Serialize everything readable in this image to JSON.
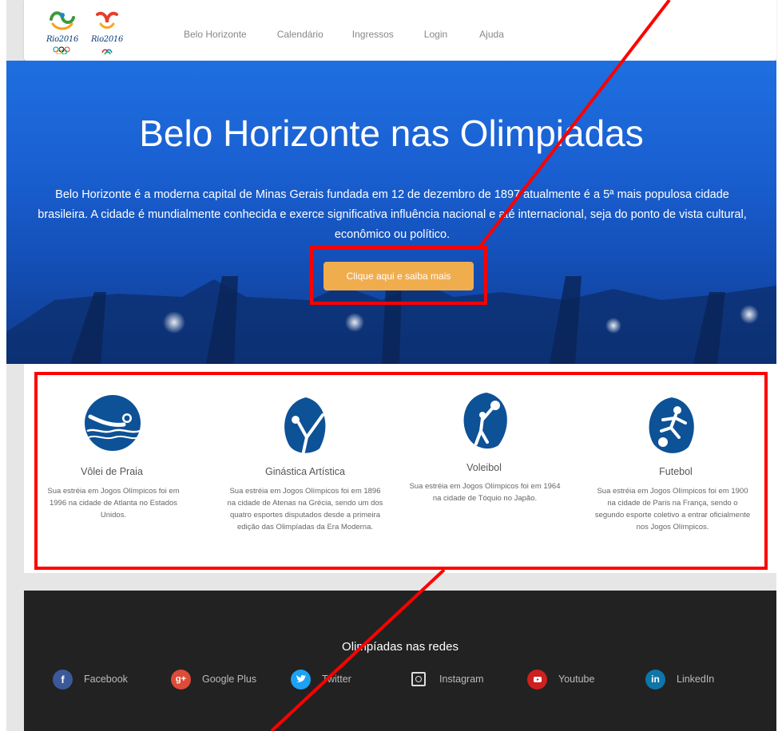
{
  "colors": {
    "hero_blue": "#1a60d2",
    "button_orange": "#f0ad4e",
    "sport_icon_blue": "#0d5196",
    "footer_dark": "#222222",
    "annotation_red": "#ff0000"
  },
  "navbar": {
    "logos": [
      {
        "icon": "rio2016-olympic-logo-icon",
        "text": "Rio2016"
      },
      {
        "icon": "rio2016-paralympic-logo-icon",
        "text": "Rio2016"
      }
    ],
    "links": [
      "Belo Horizonte",
      "Calendário",
      "Ingressos",
      "Login",
      "Ajuda"
    ]
  },
  "hero": {
    "title": "Belo Horizonte nas Olimpiadas",
    "text": "Belo Horizonte é a moderna capital de Minas Gerais fundada em 12 de dezembro de 1897 atualmente é a 5ª mais populosa cidade brasileira. A cidade é mundialmente conhecida e exerce significativa influência nacional e até internacional, seja do ponto de vista cultural, econômico ou político.",
    "button_label": "Clique aqui e saiba mais"
  },
  "sports": [
    {
      "icon": "beach-volleyball-icon",
      "name": "Vôlei de Praia",
      "description": "Sua estréia em Jogos Olímpicos foi em 1996 na cidade de Atlanta no Estados Unidos."
    },
    {
      "icon": "artistic-gymnastics-icon",
      "name": "Ginástica Artística",
      "description": "Sua estréia em Jogos Olímpicos foi em 1896 na cidade de Atenas na Grécia, sendo um dos quatro esportes disputados desde a primeira edição das Olimpíadas da Era Moderna."
    },
    {
      "icon": "volleyball-icon",
      "name": "Voleibol",
      "description": "Sua estréia em Jogos Olímpicos foi em 1964 na cidade de Tóquio no Japão."
    },
    {
      "icon": "football-icon",
      "name": "Futebol",
      "description": "Sua estréia em Jogos Olímpicos foi em 1900 na cidade de Paris na França, sendo o segundo esporte coletivo a entrar oficialmente nos Jogos Olímpicos."
    }
  ],
  "footer": {
    "title": "Olimpíadas nas redes",
    "social": [
      {
        "icon": "facebook-icon",
        "label": "Facebook",
        "color": "#3b5998"
      },
      {
        "icon": "google-plus-icon",
        "label": "Google Plus",
        "color": "#dd4b39"
      },
      {
        "icon": "twitter-icon",
        "label": "Twitter",
        "color": "#1da1f2"
      },
      {
        "icon": "instagram-icon",
        "label": "Instagram",
        "color": "#222222"
      },
      {
        "icon": "youtube-icon",
        "label": "Youtube",
        "color": "#cd201f"
      },
      {
        "icon": "linkedin-icon",
        "label": "LinkedIn",
        "color": "#0e76a8"
      }
    ]
  }
}
